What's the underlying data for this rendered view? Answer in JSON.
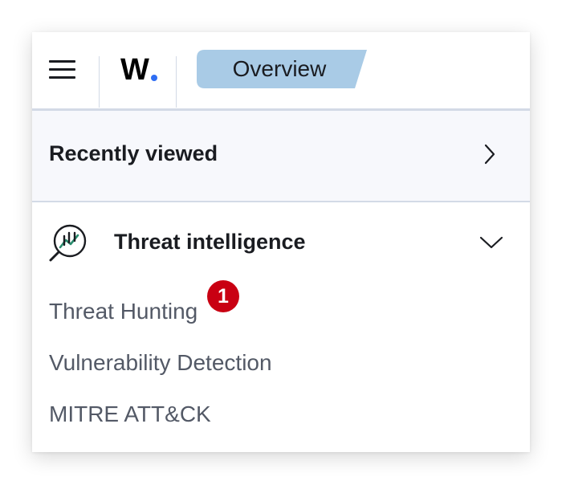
{
  "header": {
    "logo_letter": "W",
    "logo_dot_color": "#2f6ef3",
    "breadcrumb": "Overview",
    "breadcrumb_color": "#a9cbe6"
  },
  "recently_viewed": {
    "label": "Recently viewed"
  },
  "threat_intelligence": {
    "label": "Threat intelligence",
    "items": [
      {
        "label": "Threat Hunting",
        "badge": "1"
      },
      {
        "label": "Vulnerability Detection"
      },
      {
        "label": "MITRE ATT&CK"
      }
    ]
  },
  "colors": {
    "badge": "#c90012",
    "icon_accent": "#2a8c6e",
    "divider": "#d3dae6"
  }
}
